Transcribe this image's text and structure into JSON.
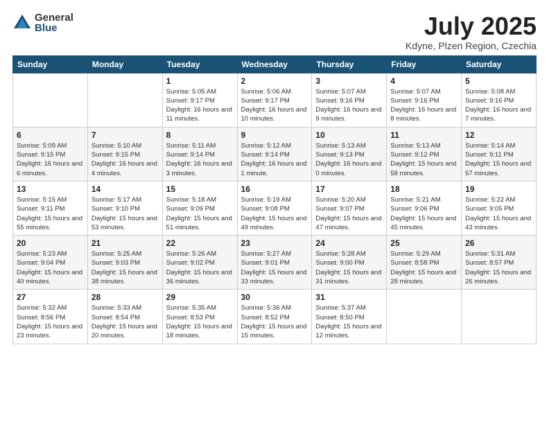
{
  "header": {
    "logo_general": "General",
    "logo_blue": "Blue",
    "month_title": "July 2025",
    "location": "Kdyne, Plzen Region, Czechia"
  },
  "weekdays": [
    "Sunday",
    "Monday",
    "Tuesday",
    "Wednesday",
    "Thursday",
    "Friday",
    "Saturday"
  ],
  "weeks": [
    [
      {
        "day": "",
        "info": ""
      },
      {
        "day": "",
        "info": ""
      },
      {
        "day": "1",
        "info": "Sunrise: 5:05 AM\nSunset: 9:17 PM\nDaylight: 16 hours and 11 minutes."
      },
      {
        "day": "2",
        "info": "Sunrise: 5:06 AM\nSunset: 9:17 PM\nDaylight: 16 hours and 10 minutes."
      },
      {
        "day": "3",
        "info": "Sunrise: 5:07 AM\nSunset: 9:16 PM\nDaylight: 16 hours and 9 minutes."
      },
      {
        "day": "4",
        "info": "Sunrise: 5:07 AM\nSunset: 9:16 PM\nDaylight: 16 hours and 8 minutes."
      },
      {
        "day": "5",
        "info": "Sunrise: 5:08 AM\nSunset: 9:16 PM\nDaylight: 16 hours and 7 minutes."
      }
    ],
    [
      {
        "day": "6",
        "info": "Sunrise: 5:09 AM\nSunset: 9:15 PM\nDaylight: 16 hours and 6 minutes."
      },
      {
        "day": "7",
        "info": "Sunrise: 5:10 AM\nSunset: 9:15 PM\nDaylight: 16 hours and 4 minutes."
      },
      {
        "day": "8",
        "info": "Sunrise: 5:11 AM\nSunset: 9:14 PM\nDaylight: 16 hours and 3 minutes."
      },
      {
        "day": "9",
        "info": "Sunrise: 5:12 AM\nSunset: 9:14 PM\nDaylight: 16 hours and 1 minute."
      },
      {
        "day": "10",
        "info": "Sunrise: 5:13 AM\nSunset: 9:13 PM\nDaylight: 16 hours and 0 minutes."
      },
      {
        "day": "11",
        "info": "Sunrise: 5:13 AM\nSunset: 9:12 PM\nDaylight: 15 hours and 58 minutes."
      },
      {
        "day": "12",
        "info": "Sunrise: 5:14 AM\nSunset: 9:11 PM\nDaylight: 15 hours and 57 minutes."
      }
    ],
    [
      {
        "day": "13",
        "info": "Sunrise: 5:15 AM\nSunset: 9:11 PM\nDaylight: 15 hours and 55 minutes."
      },
      {
        "day": "14",
        "info": "Sunrise: 5:17 AM\nSunset: 9:10 PM\nDaylight: 15 hours and 53 minutes."
      },
      {
        "day": "15",
        "info": "Sunrise: 5:18 AM\nSunset: 9:09 PM\nDaylight: 15 hours and 51 minutes."
      },
      {
        "day": "16",
        "info": "Sunrise: 5:19 AM\nSunset: 9:08 PM\nDaylight: 15 hours and 49 minutes."
      },
      {
        "day": "17",
        "info": "Sunrise: 5:20 AM\nSunset: 9:07 PM\nDaylight: 15 hours and 47 minutes."
      },
      {
        "day": "18",
        "info": "Sunrise: 5:21 AM\nSunset: 9:06 PM\nDaylight: 15 hours and 45 minutes."
      },
      {
        "day": "19",
        "info": "Sunrise: 5:22 AM\nSunset: 9:05 PM\nDaylight: 15 hours and 43 minutes."
      }
    ],
    [
      {
        "day": "20",
        "info": "Sunrise: 5:23 AM\nSunset: 9:04 PM\nDaylight: 15 hours and 40 minutes."
      },
      {
        "day": "21",
        "info": "Sunrise: 5:25 AM\nSunset: 9:03 PM\nDaylight: 15 hours and 38 minutes."
      },
      {
        "day": "22",
        "info": "Sunrise: 5:26 AM\nSunset: 9:02 PM\nDaylight: 15 hours and 36 minutes."
      },
      {
        "day": "23",
        "info": "Sunrise: 5:27 AM\nSunset: 9:01 PM\nDaylight: 15 hours and 33 minutes."
      },
      {
        "day": "24",
        "info": "Sunrise: 5:28 AM\nSunset: 9:00 PM\nDaylight: 15 hours and 31 minutes."
      },
      {
        "day": "25",
        "info": "Sunrise: 5:29 AM\nSunset: 8:58 PM\nDaylight: 15 hours and 28 minutes."
      },
      {
        "day": "26",
        "info": "Sunrise: 5:31 AM\nSunset: 8:57 PM\nDaylight: 15 hours and 26 minutes."
      }
    ],
    [
      {
        "day": "27",
        "info": "Sunrise: 5:32 AM\nSunset: 8:56 PM\nDaylight: 15 hours and 23 minutes."
      },
      {
        "day": "28",
        "info": "Sunrise: 5:33 AM\nSunset: 8:54 PM\nDaylight: 15 hours and 20 minutes."
      },
      {
        "day": "29",
        "info": "Sunrise: 5:35 AM\nSunset: 8:53 PM\nDaylight: 15 hours and 18 minutes."
      },
      {
        "day": "30",
        "info": "Sunrise: 5:36 AM\nSunset: 8:52 PM\nDaylight: 15 hours and 15 minutes."
      },
      {
        "day": "31",
        "info": "Sunrise: 5:37 AM\nSunset: 8:50 PM\nDaylight: 15 hours and 12 minutes."
      },
      {
        "day": "",
        "info": ""
      },
      {
        "day": "",
        "info": ""
      }
    ]
  ]
}
